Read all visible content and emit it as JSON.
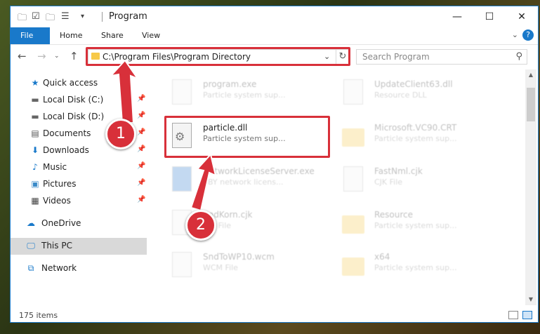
{
  "window": {
    "title": "Program",
    "minimize": "—",
    "maximize": "☐",
    "close": "✕"
  },
  "ribbon": {
    "tabs": [
      "File",
      "Home",
      "Share",
      "View"
    ],
    "chevron": "⌄",
    "help": "?"
  },
  "nav": {
    "address": "C:\\Program Files\\Program Directory",
    "search_placeholder": "Search Program"
  },
  "sidebar": {
    "items": [
      {
        "label": "Quick access",
        "icon": "star-icon",
        "pinned": false
      },
      {
        "label": "Local Disk (C:)",
        "icon": "drive-icon",
        "pinned": true
      },
      {
        "label": "Local Disk (D:)",
        "icon": "drive-icon",
        "pinned": true
      },
      {
        "label": "Documents",
        "icon": "documents-icon",
        "pinned": true
      },
      {
        "label": "Downloads",
        "icon": "download-icon",
        "pinned": true
      },
      {
        "label": "Music",
        "icon": "music-icon",
        "pinned": true
      },
      {
        "label": "Pictures",
        "icon": "pictures-icon",
        "pinned": true
      },
      {
        "label": "Videos",
        "icon": "videos-icon",
        "pinned": true
      },
      {
        "label": "OneDrive",
        "icon": "cloud-icon",
        "pinned": false
      },
      {
        "label": "This PC",
        "icon": "pc-icon",
        "pinned": false,
        "selected": true
      },
      {
        "label": "Network",
        "icon": "network-icon",
        "pinned": false
      }
    ]
  },
  "files": [
    {
      "name": "program.exe",
      "desc": "Particle system sup...",
      "faded": true
    },
    {
      "name": "UpdateClient63.dll",
      "desc": "Resource DLL",
      "faded": true
    },
    {
      "name": "particle.dll",
      "desc": "Particle system sup...",
      "faded": false
    },
    {
      "name": "Microsoft.VC90.CRT",
      "desc": "Particle system sup...",
      "faded": true
    },
    {
      "name": "NetworkLicenseServer.exe",
      "desc": "SBY network licens...",
      "faded": true
    },
    {
      "name": "FastNml.cjk",
      "desc": "CJK File",
      "faded": true
    },
    {
      "name": "SndKorn.cjk",
      "desc": "CJK File",
      "faded": true
    },
    {
      "name": "Resource",
      "desc": "Particle system sup...",
      "faded": true
    },
    {
      "name": "SndToWP10.wcm",
      "desc": "WCM File",
      "faded": true
    },
    {
      "name": "x64",
      "desc": "Particle system sup...",
      "faded": true
    }
  ],
  "status": {
    "count": "175 items"
  },
  "annotations": {
    "step1": "1",
    "step2": "2"
  },
  "colors": {
    "accent": "#1979ca",
    "highlight": "#d8303a",
    "folder": "#f7c948"
  }
}
